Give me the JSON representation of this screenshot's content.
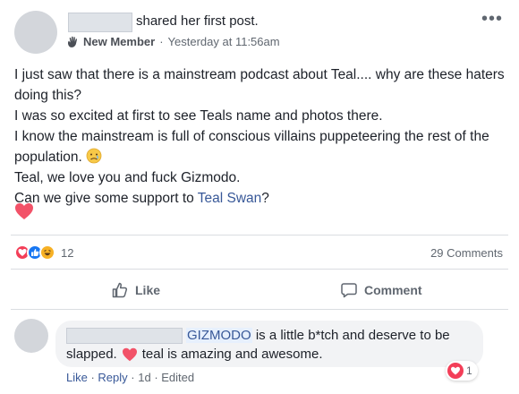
{
  "post": {
    "action_text": "shared her first post.",
    "badge": "New Member",
    "separator": "·",
    "timestamp": "Yesterday at 11:56am",
    "more_label": "•••",
    "lines": {
      "l1": "I just saw that there is a mainstream podcast about Teal.... why are these haters doing this?",
      "l2": "I was so excited at first to see Teals name and photos there.",
      "l3": "I know the mainstream is full of conscious villains puppeteering the rest of the population.",
      "l4": "Teal, we love you and fuck Gizmodo.",
      "l5_prefix": "Can we give some support to ",
      "l5_link": "Teal Swan",
      "l5_suffix": "?"
    },
    "emoji_icon": "sad-face-emoji",
    "trailing_icon": "heart-emoji"
  },
  "stats": {
    "reaction_icons": [
      "love-reaction-icon",
      "like-reaction-icon",
      "haha-reaction-icon"
    ],
    "reaction_count": "12",
    "comments_count": "29 Comments"
  },
  "actions": {
    "like_label": "Like",
    "comment_label": "Comment"
  },
  "comment": {
    "tag": "GIZMODO",
    "text_line1": " is a little b*tch and deserve to be",
    "text_line2_a": "slapped.",
    "text_line2_b": "teal is amazing and awesome.",
    "reaction_count": "1",
    "like": "Like",
    "reply": "Reply",
    "dot": " · ",
    "age": "1d",
    "edited": "Edited"
  },
  "colors": {
    "link": "#385898",
    "love": "#f33e58",
    "like": "#1877f2",
    "haha": "#f7b125",
    "muted": "#606770"
  }
}
